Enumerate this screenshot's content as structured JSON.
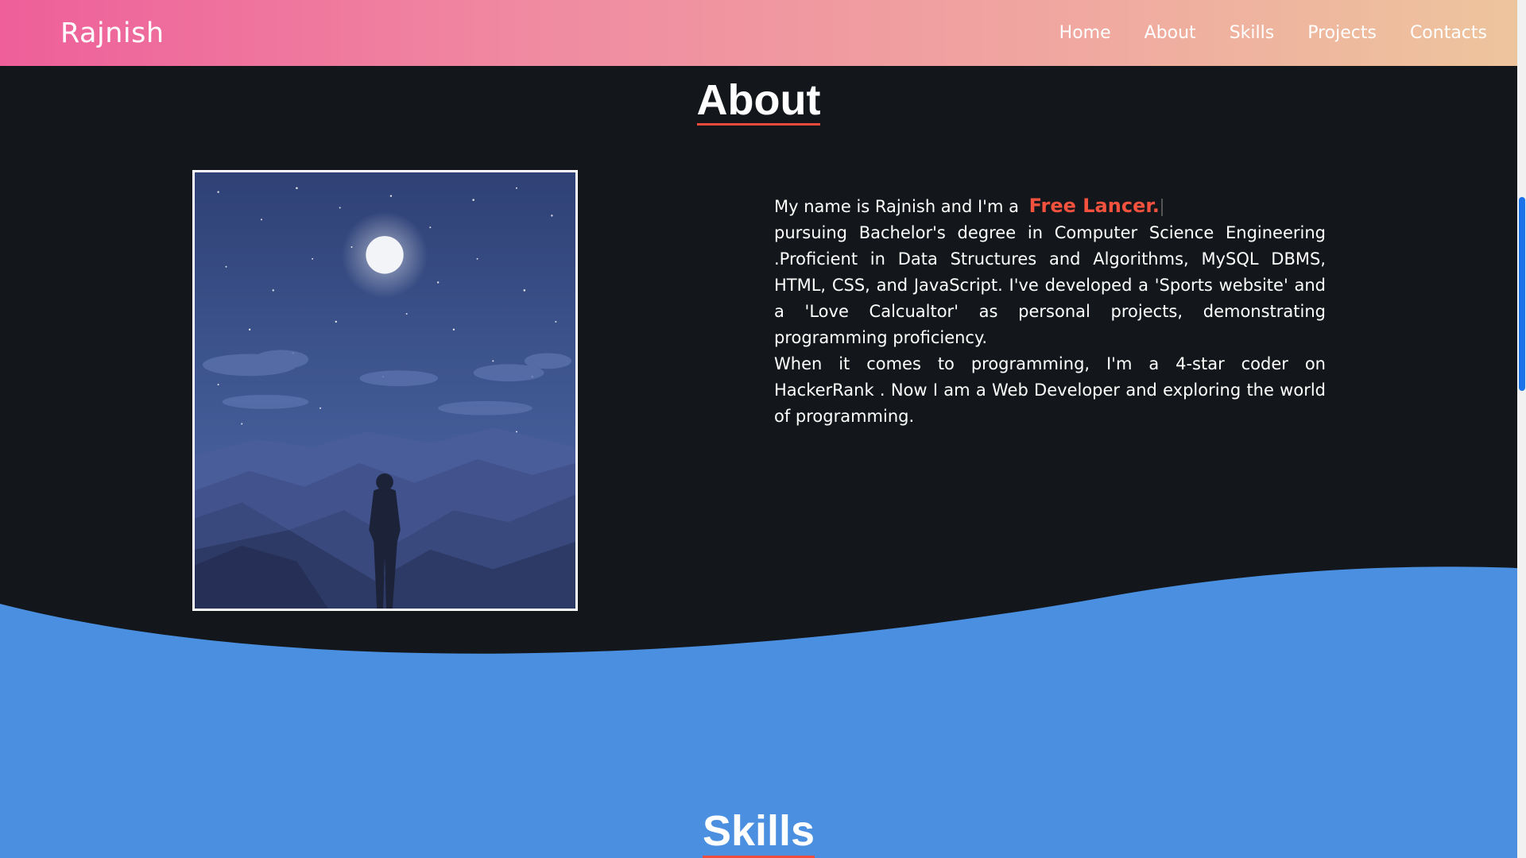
{
  "navbar": {
    "brand": "Rajnish",
    "links": [
      {
        "label": "Home"
      },
      {
        "label": "About"
      },
      {
        "label": "Skills"
      },
      {
        "label": "Projects"
      },
      {
        "label": "Contacts"
      }
    ]
  },
  "about": {
    "title": "About",
    "intro_prefix": "My name is Rajnish and I'm a",
    "typed_role": "Free Lancer.",
    "paragraph1": "pursuing Bachelor's degree in Computer Science Engineering .Proficient in Data Structures and Algorithms, MySQL DBMS, HTML, CSS, and JavaScript. I've developed a 'Sports website' and a 'Love Calcualtor' as personal projects, demonstrating programming proficiency.",
    "paragraph2": "When it comes to programming, I'm a 4-star coder on HackerRank . Now I am a Web Developer and exploring the world of programming."
  },
  "skills": {
    "title": "Skills"
  },
  "colors": {
    "navbar_gradient_start": "#ee5f9a",
    "navbar_gradient_end": "#edc59d",
    "background_dark": "#13171b",
    "wave_blue": "#4a8fe0",
    "highlight_red": "#f4523e",
    "scrollbar_thumb": "#1a73e8"
  },
  "icons": {
    "profile_image": "night-mountain-illustration"
  }
}
